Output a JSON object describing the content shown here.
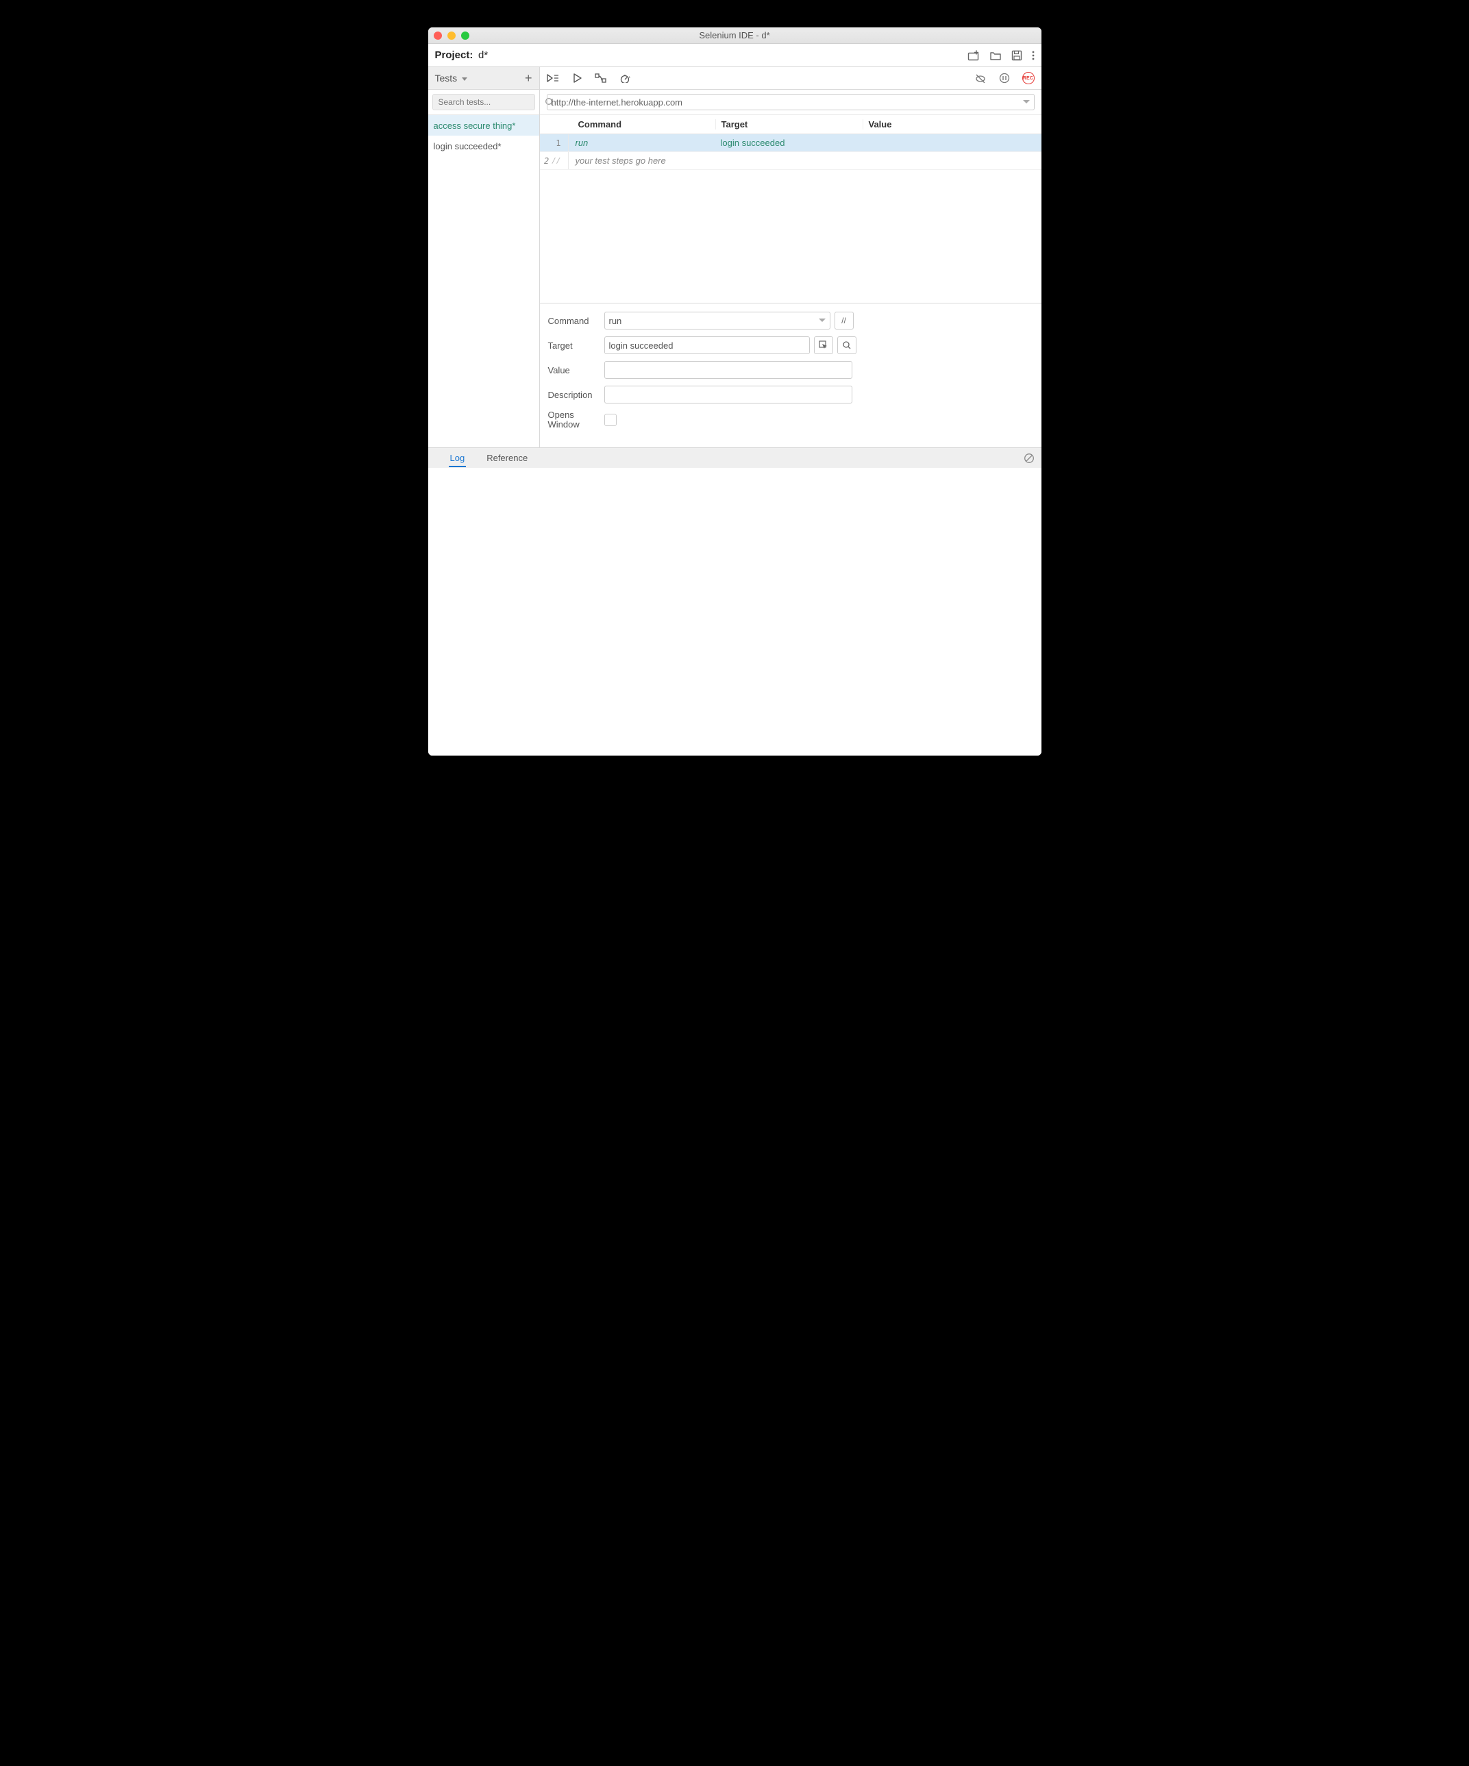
{
  "window": {
    "title": "Selenium IDE - d*"
  },
  "project": {
    "label": "Project:",
    "name": "d*"
  },
  "sidebar": {
    "heading": "Tests",
    "search_placeholder": "Search tests...",
    "tests": [
      {
        "label": "access secure thing*",
        "selected": true
      },
      {
        "label": "login succeeded*",
        "selected": false
      }
    ]
  },
  "url_bar": {
    "value": "http://the-internet.herokuapp.com"
  },
  "grid": {
    "headers": {
      "command": "Command",
      "target": "Target",
      "value": "Value"
    },
    "steps": [
      {
        "num": "1",
        "command": "run",
        "target": "login succeeded",
        "value": "",
        "selected": true,
        "comment": false
      },
      {
        "num": "2",
        "command": "your test steps go here",
        "target": "",
        "value": "",
        "selected": false,
        "comment": true
      }
    ]
  },
  "detail": {
    "labels": {
      "command": "Command",
      "target": "Target",
      "value": "Value",
      "description": "Description",
      "opens_window": "Opens Window"
    },
    "command": "run",
    "target": "login succeeded",
    "value": "",
    "description": "",
    "comment_btn": "//"
  },
  "bottom_tabs": {
    "log": "Log",
    "reference": "Reference"
  }
}
